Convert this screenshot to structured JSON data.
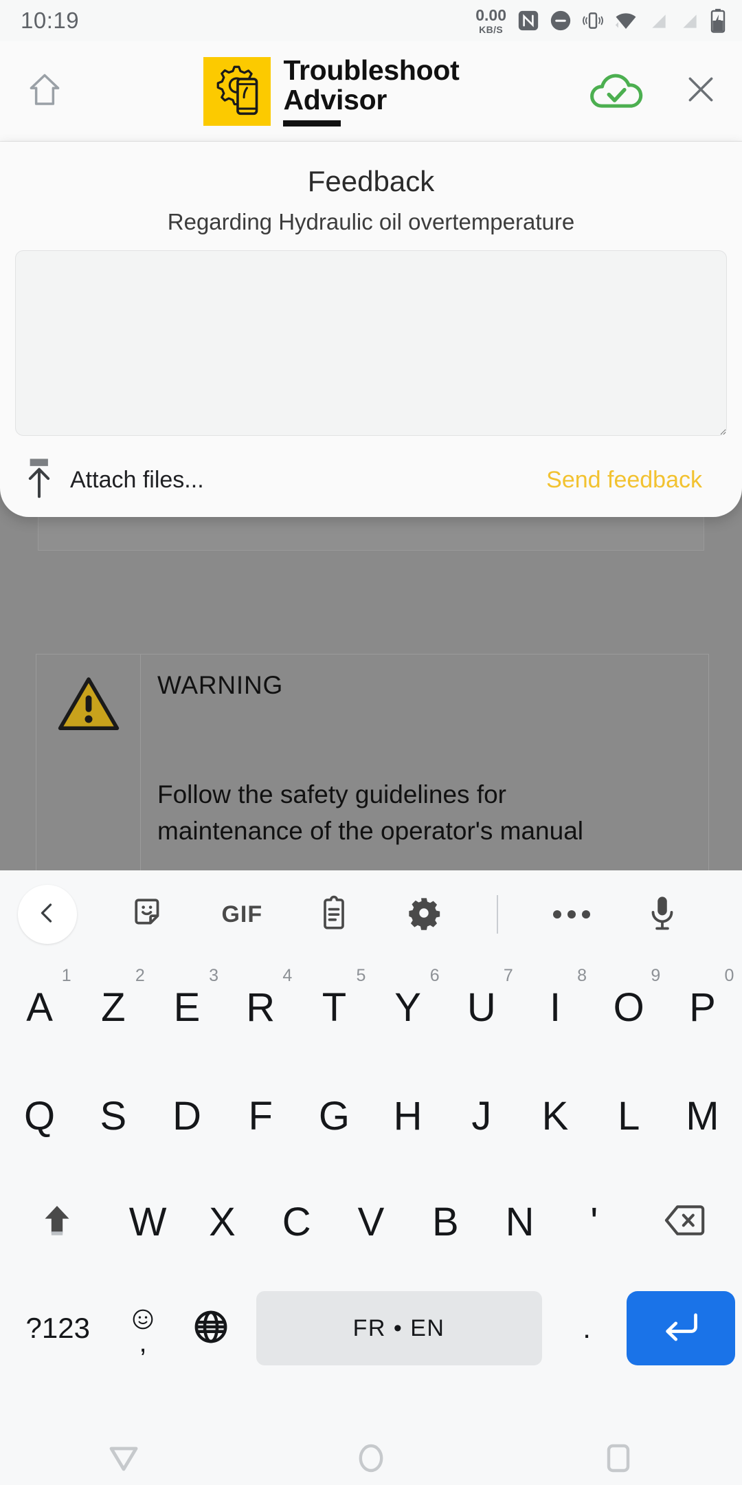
{
  "status_bar": {
    "clock": "10:19",
    "net_speed_value": "0.00",
    "net_speed_unit": "KB/S",
    "icons": [
      "nfc-icon",
      "do-not-disturb-icon",
      "vibrate-icon",
      "wifi-icon",
      "signal-off-icon",
      "signal-off-2-icon",
      "battery-charging-icon"
    ]
  },
  "app_bar": {
    "home_icon": "home-icon",
    "logo_icon": "gear-phone-logo",
    "title_line1": "Troubleshoot",
    "title_line2": "Advisor",
    "cloud_icon": "cloud-check-icon",
    "close_icon": "close-icon",
    "brand_color": "#fcca00",
    "cloud_color": "#4caf50"
  },
  "dialog": {
    "title": "Feedback",
    "subtitle": "Regarding Hydraulic oil overtemperature",
    "textarea_value": "",
    "textarea_placeholder": "",
    "attach_label": "Attach files...",
    "attach_icon": "upload-icon",
    "send_label": "Send feedback",
    "send_color": "#f2c230"
  },
  "background_page": {
    "warning_title": "WARNING",
    "warning_icon": "warning-triangle-icon",
    "warning_text_line1": "Follow the safety guidelines for",
    "warning_text_line2": "maintenance of the operator's manual"
  },
  "keyboard": {
    "toolbar": {
      "back_icon": "chevron-left-icon",
      "sticker_icon": "sticker-icon",
      "gif_label": "GIF",
      "clipboard_icon": "clipboard-icon",
      "settings_icon": "gear-icon",
      "overflow_icon": "more-dots-icon",
      "mic_icon": "microphone-icon"
    },
    "row1": [
      {
        "key": "A",
        "num": "1"
      },
      {
        "key": "Z",
        "num": "2"
      },
      {
        "key": "E",
        "num": "3"
      },
      {
        "key": "R",
        "num": "4"
      },
      {
        "key": "T",
        "num": "5"
      },
      {
        "key": "Y",
        "num": "6"
      },
      {
        "key": "U",
        "num": "7"
      },
      {
        "key": "I",
        "num": "8"
      },
      {
        "key": "O",
        "num": "9"
      },
      {
        "key": "P",
        "num": "0"
      }
    ],
    "row2": [
      "Q",
      "S",
      "D",
      "F",
      "G",
      "H",
      "J",
      "K",
      "L",
      "M"
    ],
    "row3": {
      "shift_icon": "shift-icon",
      "keys": [
        "W",
        "X",
        "C",
        "V",
        "B",
        "N",
        "'"
      ],
      "backspace_icon": "backspace-icon"
    },
    "row4": {
      "symbols_label": "?123",
      "emoji_icon": "emoji-icon",
      "comma_label": ",",
      "globe_icon": "globe-icon",
      "space_label": "FR • EN",
      "period_label": ".",
      "enter_icon": "enter-icon",
      "enter_color": "#1a73e8"
    }
  },
  "nav_bar": {
    "back_icon": "nav-back-triangle-icon",
    "home_icon": "nav-home-circle-icon",
    "recents_icon": "nav-recents-square-icon"
  }
}
